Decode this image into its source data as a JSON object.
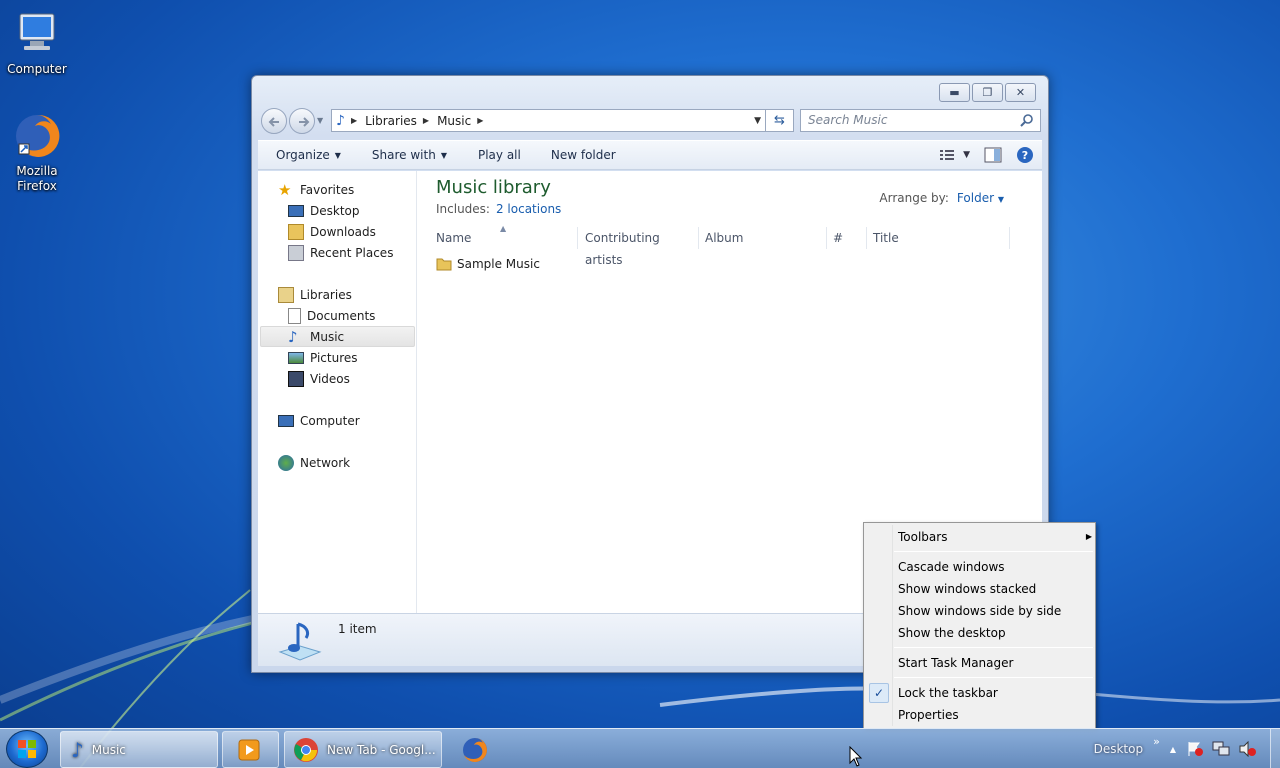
{
  "desktop": {
    "icons": [
      {
        "label": "Computer"
      },
      {
        "label": "Mozilla Firefox"
      }
    ]
  },
  "window": {
    "breadcrumb": [
      "Libraries",
      "Music"
    ],
    "search_placeholder": "Search Music",
    "toolbar": {
      "organize": "Organize",
      "share_with": "Share with",
      "play_all": "Play all",
      "new_folder": "New folder"
    },
    "nav": {
      "favorites": "Favorites",
      "desktop": "Desktop",
      "downloads": "Downloads",
      "recent_places": "Recent Places",
      "libraries": "Libraries",
      "documents": "Documents",
      "music": "Music",
      "pictures": "Pictures",
      "videos": "Videos",
      "computer": "Computer",
      "network": "Network"
    },
    "library": {
      "title": "Music library",
      "includes_label": "Includes:",
      "includes_link": "2 locations",
      "arrange_label": "Arrange by:",
      "arrange_value": "Folder"
    },
    "columns": [
      "Name",
      "Contributing artists",
      "Album",
      "#",
      "Title"
    ],
    "files": [
      {
        "name": "Sample Music"
      }
    ],
    "status": "1 item"
  },
  "context_menu": {
    "items": {
      "toolbars": "Toolbars",
      "cascade": "Cascade windows",
      "stacked": "Show windows stacked",
      "side_by_side": "Show windows side by side",
      "show_desktop": "Show the desktop",
      "task_manager": "Start Task Manager",
      "lock_taskbar": "Lock the taskbar",
      "properties": "Properties"
    },
    "lock_checked": true
  },
  "taskbar": {
    "music_label": "Music",
    "chrome_label": "New Tab - Googl...",
    "desktop_label": "Desktop"
  },
  "colors": {
    "accent_link": "#1a5eae",
    "library_title": "#1e5b2e"
  }
}
